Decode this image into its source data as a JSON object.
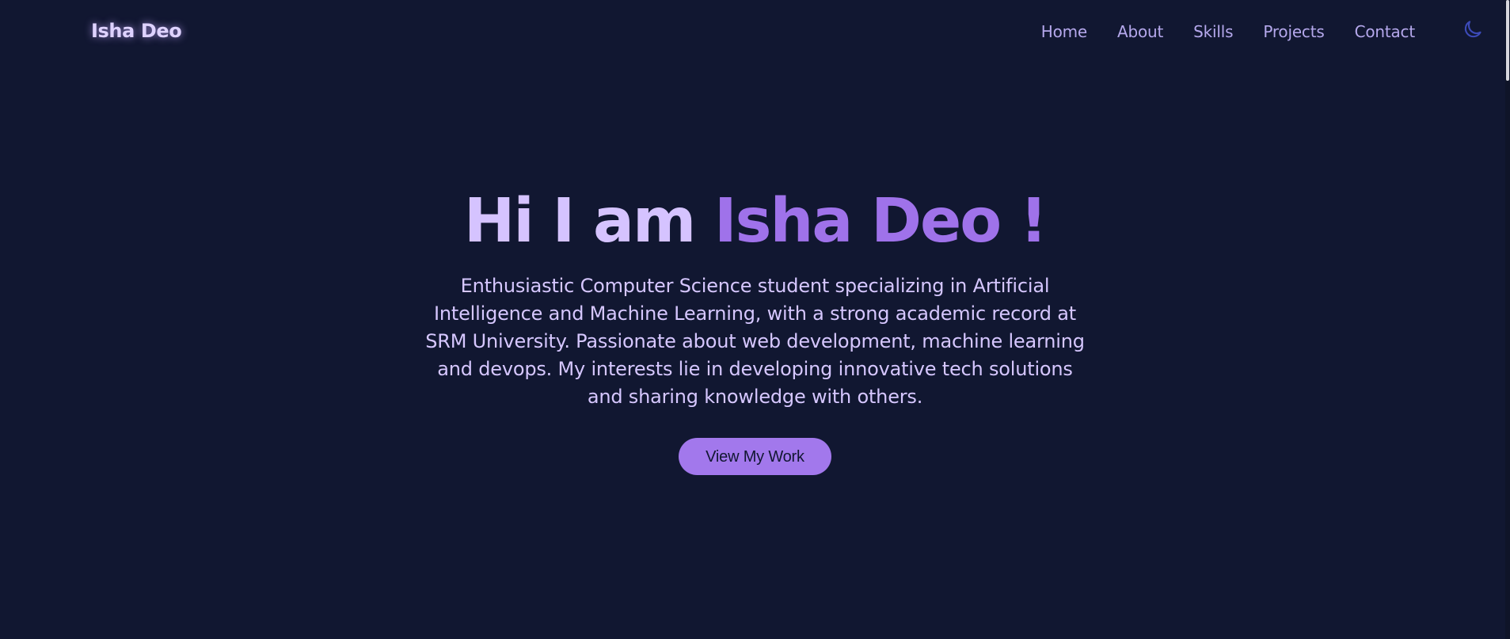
{
  "nav": {
    "logo": "Isha Deo",
    "links": [
      "Home",
      "About",
      "Skills",
      "Projects",
      "Contact"
    ],
    "theme_icon": "moon-icon"
  },
  "hero": {
    "title_prefix": "Hi I am ",
    "title_name": "Isha Deo !",
    "description": "Enthusiastic Computer Science student specializing in Artificial Intelligence and Machine Learning, with a strong academic record at SRM University. Passionate about web development, machine learning and devops. My interests lie in developing innovative tech solutions and sharing knowledge with others.",
    "button_label": "View My Work"
  },
  "colors": {
    "background": "#111731",
    "accent": "#a278ec",
    "heading": "#d5c3ff",
    "nav_text": "#b5a8ec"
  }
}
